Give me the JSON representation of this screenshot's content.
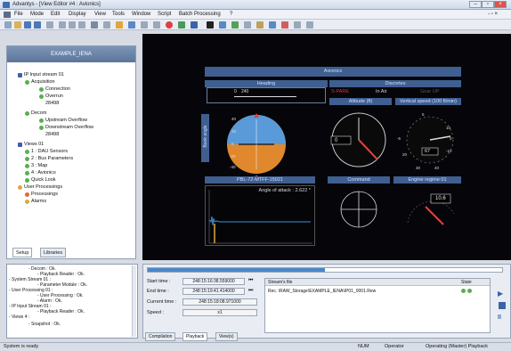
{
  "window": {
    "title": "Advantys - [View Editor #4 : Avionics]"
  },
  "menu": [
    "File",
    "Mode",
    "Edit",
    "Display",
    "View",
    "Tools",
    "Window",
    "Script",
    "Batch Processing",
    "?"
  ],
  "left_panel": {
    "header": "EXAMPLE_IENA",
    "tree": [
      {
        "label": "IP Input stream 01",
        "level": 0
      },
      {
        "label": "Acquisition",
        "level": 1
      },
      {
        "label": "Connection",
        "level": 2
      },
      {
        "label": "Overrun",
        "level": 2
      },
      {
        "label": "28498",
        "level": 3
      },
      {
        "label": "Decom",
        "level": 1
      },
      {
        "label": "Upstream Overflow",
        "level": 2
      },
      {
        "label": "Downstream Overflow",
        "level": 2
      },
      {
        "label": "28498",
        "level": 3
      },
      {
        "label": "Views 01",
        "level": 0
      },
      {
        "label": "1 : DAU Sensors",
        "level": 1
      },
      {
        "label": "2 : Bus Parameters",
        "level": 1
      },
      {
        "label": "3 : Map",
        "level": 1
      },
      {
        "label": "4 : Avionics",
        "level": 1
      },
      {
        "label": "Quick Look",
        "level": 1
      },
      {
        "label": "User Processings",
        "level": 0
      },
      {
        "label": "Processings",
        "level": 1
      },
      {
        "label": "Alarms",
        "level": 1
      }
    ],
    "tabs": [
      "Setup",
      "Libraries"
    ]
  },
  "viewer": {
    "title": "Avionics",
    "heading_label": "Heading",
    "heading_scale": [
      "0",
      "240"
    ],
    "discretes_label": "Discretes",
    "discretes": [
      "S-PARE",
      "In Air",
      "Gear UP"
    ],
    "altitude_label": "Altitude (ft)",
    "vspeed_label": "Vertical speed (100 ft/min)",
    "horizon_side_label": "Bank angle",
    "horizon_ticks": [
      "40",
      "20",
      "0",
      "-20",
      "-40"
    ],
    "alt_readout": "0",
    "vs_ticks": [
      "5",
      "10",
      "0",
      "-5",
      "-10",
      "20",
      "30",
      "40"
    ],
    "vs_readout": "67",
    "aoa_panel_label": "PBL-72-MTFF-15021",
    "aoa_title": "Angle of attack : 2.622 °",
    "command_label": "Command",
    "engine_label": "Engine regime 01",
    "engine_readout": "10.6"
  },
  "log": [
    "- Decom : Ok.",
    "- Playback Reader : Ok.",
    "- System Stream 01 :",
    "- Parameter Module : Ok.",
    "- User Processing 01 :",
    "- User Processing : Ok.",
    "- Alarm : Ok.",
    "- IP Input Stream 01 :",
    "- Playback Reader : Ok.",
    "- Views 4 :",
    "- Snapshot : Ok."
  ],
  "playback": {
    "start_label": "Start time :",
    "start_value": "248:15:16:38.559000",
    "end_label": "End time :",
    "end_value": "248:15:19:41.414000",
    "current_label": "Current time :",
    "current_value": "248:15:18:08.971000",
    "speed_label": "Speed :",
    "speed_value": "x1",
    "file_header": "Stream's file",
    "state_header": "State",
    "file_path": "Rec. \\RAW_Storage\\EXAMPLE_IENA\\IP01_0001.Rew"
  },
  "bottom_tabs": [
    "Compilation",
    "Playback",
    "View(s)"
  ],
  "status": {
    "left": "System is ready",
    "num": "NUM",
    "operator": "Operator",
    "mode": "Operating (Master) Playback"
  }
}
